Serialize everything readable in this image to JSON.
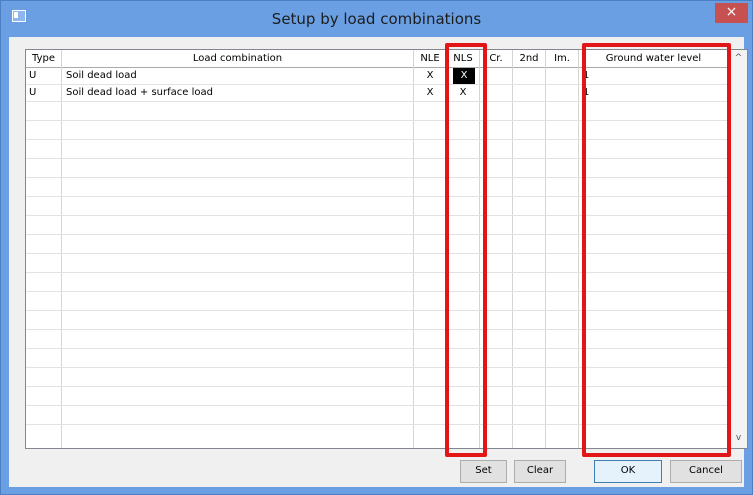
{
  "window": {
    "title": "Setup by load combinations",
    "close_glyph": "×"
  },
  "table": {
    "columns": [
      "Type",
      "Load combination",
      "NLE",
      "NLS",
      "Cr.",
      "2nd",
      "Im.",
      "Ground water level"
    ],
    "rows": [
      {
        "type": "U",
        "combination": "Soil dead load",
        "nle": "X",
        "nls": "X",
        "cr": "",
        "second": "",
        "im": "",
        "gwl": "1"
      },
      {
        "type": "U",
        "combination": "Soil dead load + surface load",
        "nle": "X",
        "nls": "X",
        "cr": "",
        "second": "",
        "im": "",
        "gwl": "1"
      }
    ]
  },
  "scrollbar": {
    "up_glyph": "^",
    "down_glyph": "v"
  },
  "buttons": {
    "set": "Set",
    "clear": "Clear",
    "ok": "OK",
    "cancel": "Cancel"
  },
  "colors": {
    "highlight": "#e21616",
    "title_bar": "#6a9fe3",
    "close": "#c75050"
  }
}
